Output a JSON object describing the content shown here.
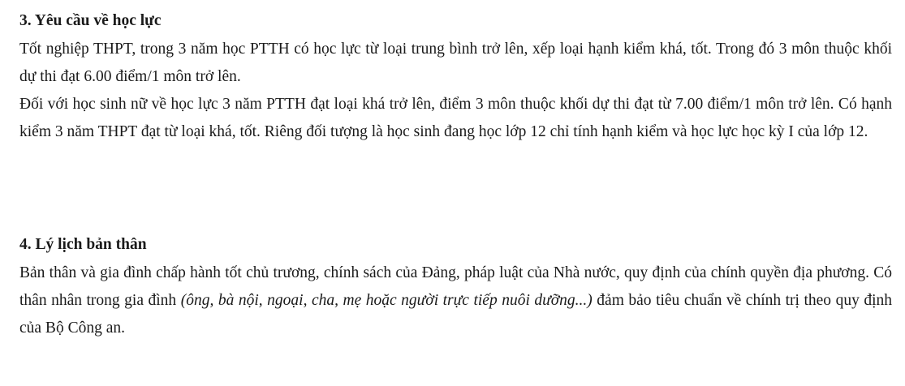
{
  "section3": {
    "heading": "3. Yêu cầu về học lực",
    "paragraph1": "Tốt nghiệp THPT, trong 3 năm học PTTH có học lực từ loại trung bình trở lên, xếp loại hạnh kiểm khá, tốt. Trong đó 3 môn thuộc khối dự thi đạt 6.00 điểm/1 môn trở lên.",
    "paragraph2": "Đối với học sinh nữ về học lực 3 năm PTTH đạt loại khá trở lên, điểm 3 môn thuộc khối dự thi đạt từ 7.00 điểm/1 môn trở lên. Có hạnh kiểm 3 năm THPT đạt từ loại khá, tốt. Riêng đối tượng là học sinh đang học lớp 12 chỉ tính hạnh kiểm và học lực học kỳ I của lớp 12."
  },
  "section4": {
    "heading": "4. Lý lịch bản thân",
    "paragraph_before_italic": "Bản thân và gia đình chấp hành tốt chủ trương, chính sách của Đảng, pháp luật của Nhà nước, quy định của chính quyền địa phương. Có thân nhân trong gia đình ",
    "paragraph_italic": "(ông, bà nội, ngoại, cha, mẹ hoặc người trực tiếp nuôi dưỡng...)",
    "paragraph_after_italic": " đảm bảo tiêu chuẩn về chính trị theo quy định của Bộ Công an."
  }
}
